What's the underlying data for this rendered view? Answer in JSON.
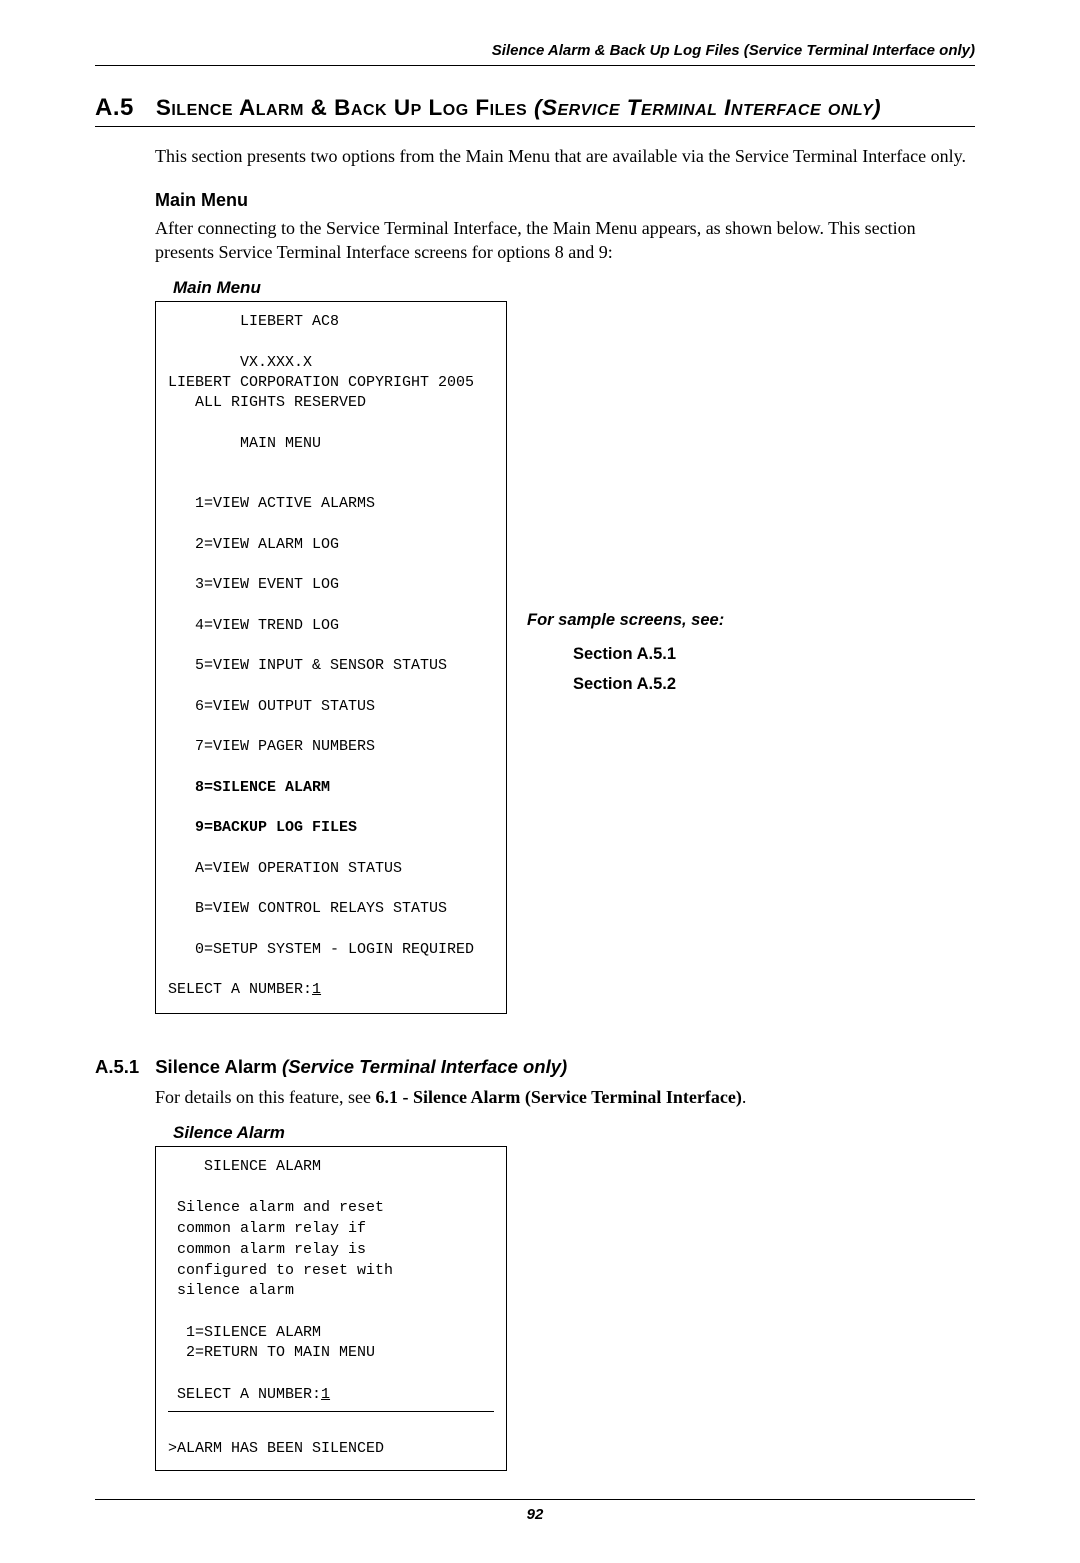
{
  "running_head": "Silence Alarm & Back Up Log Files (Service Terminal Interface only)",
  "section": {
    "number": "A.5",
    "title_sc": "Silence Alarm & Back Up Log Files ",
    "title_italic": "(Service Terminal Interface only)"
  },
  "intro": "This section presents two options from the Main Menu that are available via the Service Terminal Interface only.",
  "main_menu": {
    "heading": "Main Menu",
    "para": "After connecting to the Service Terminal Interface, the Main Menu appears, as shown below. This section presents Service Terminal Interface screens for options 8 and 9:",
    "box_label": "Main Menu",
    "screen": {
      "l1": "        LIEBERT AC8",
      "l2": "",
      "l3": "        VX.XXX.X",
      "l4": "LIEBERT CORPORATION COPYRIGHT 2005",
      "l5": "   ALL RIGHTS RESERVED",
      "l6": "",
      "l7": "        MAIN MENU",
      "l8": "",
      "l9": "",
      "l10": "   1=VIEW ACTIVE ALARMS",
      "l11": "",
      "l12": "   2=VIEW ALARM LOG",
      "l13": "",
      "l14": "   3=VIEW EVENT LOG",
      "l15": "",
      "l16": "   4=VIEW TREND LOG",
      "l17": "",
      "l18": "   5=VIEW INPUT & SENSOR STATUS",
      "l19": "",
      "l20": "   6=VIEW OUTPUT STATUS",
      "l21": "",
      "l22": "   7=VIEW PAGER NUMBERS",
      "l23": "",
      "l24": "   8=SILENCE ALARM",
      "l25": "",
      "l26": "   9=BACKUP LOG FILES",
      "l27": "",
      "l28": "   A=VIEW OPERATION STATUS",
      "l29": "",
      "l30": "   B=VIEW CONTROL RELAYS STATUS",
      "l31": "",
      "l32": "   0=SETUP SYSTEM - LOGIN REQUIRED",
      "l33": "",
      "prompt": "SELECT A NUMBER:",
      "input": "1"
    },
    "side": {
      "heading": "For sample screens, see:",
      "ref8": "Section A.5.1",
      "ref9": "Section A.5.2"
    }
  },
  "a51": {
    "number": "A.5.1",
    "title_plain": "Silence Alarm ",
    "title_italic": "(Service Terminal Interface only)",
    "para_pre": "For details on this feature, see ",
    "para_bold": "6.1 - Silence Alarm (Service Terminal Interface)",
    "para_post": ".",
    "box_label": "Silence Alarm",
    "screen": {
      "l1": "    SILENCE ALARM",
      "l2": "",
      "l3": " Silence alarm and reset",
      "l4": " common alarm relay if",
      "l5": " common alarm relay is",
      "l6": " configured to reset with",
      "l7": " silence alarm",
      "l8": "",
      "l9": "  1=SILENCE ALARM",
      "l10": "  2=RETURN TO MAIN MENU",
      "l11": "",
      "prompt": " SELECT A NUMBER:",
      "input": "1",
      "result": ">ALARM HAS BEEN SILENCED"
    }
  },
  "page_number": "92"
}
